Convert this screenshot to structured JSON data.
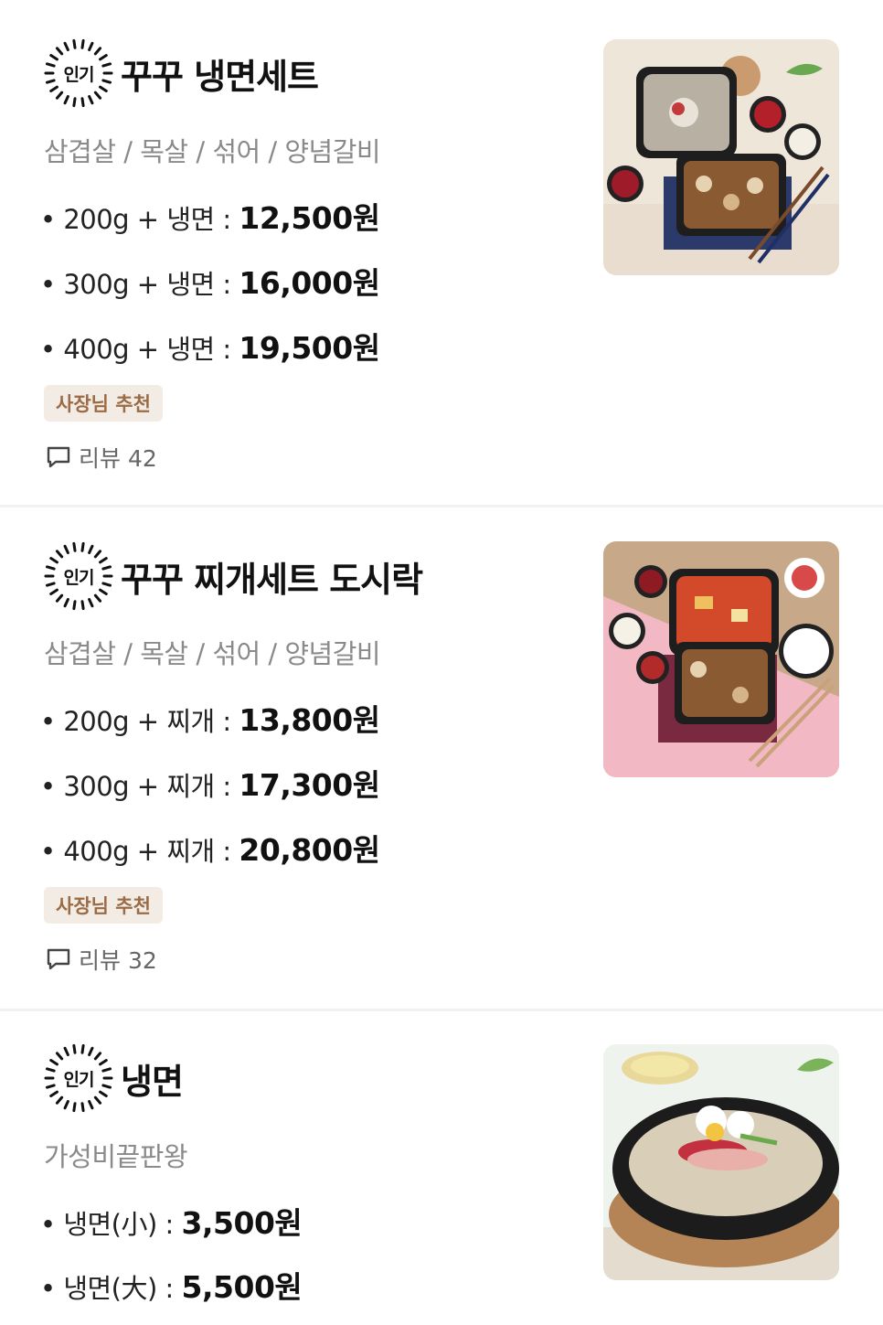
{
  "items": [
    {
      "badge": "인기",
      "title": "꾸꾸 냉면세트",
      "description": "삼겹살 / 목살 / 섞어 / 양념갈비",
      "prices": [
        {
          "label": "• 200g + 냉면 : ",
          "price": "12,500원"
        },
        {
          "label": "• 300g + 냉면 : ",
          "price": "16,000원"
        },
        {
          "label": "• 400g + 냉면 : ",
          "price": "19,500원"
        }
      ],
      "recommend": "사장님 추천",
      "review": "리뷰 42",
      "image": "naengmyeon-set-photo"
    },
    {
      "badge": "인기",
      "title": "꾸꾸 찌개세트 도시락",
      "description": "삼겹살 / 목살 / 섞어 / 양념갈비",
      "prices": [
        {
          "label": "• 200g + 찌개 : ",
          "price": "13,800원"
        },
        {
          "label": "• 300g + 찌개 : ",
          "price": "17,300원"
        },
        {
          "label": "• 400g + 찌개 : ",
          "price": "20,800원"
        }
      ],
      "recommend": "사장님 추천",
      "review": "리뷰 32",
      "image": "jjigae-set-photo"
    },
    {
      "badge": "인기",
      "title": "냉면",
      "description": "가성비끝판왕",
      "prices": [
        {
          "label": "• 냉면(小) : ",
          "price": "3,500원"
        },
        {
          "label": "• 냉면(大) : ",
          "price": "5,500원"
        }
      ],
      "image": "naengmyeon-photo"
    }
  ],
  "icons": {
    "review": "speech-bubble-icon",
    "badge": "sunburst-badge-icon"
  },
  "colors": {
    "recommend_bg": "#f3ece4",
    "recommend_text": "#9a6b45",
    "description": "#8a8a8a"
  }
}
